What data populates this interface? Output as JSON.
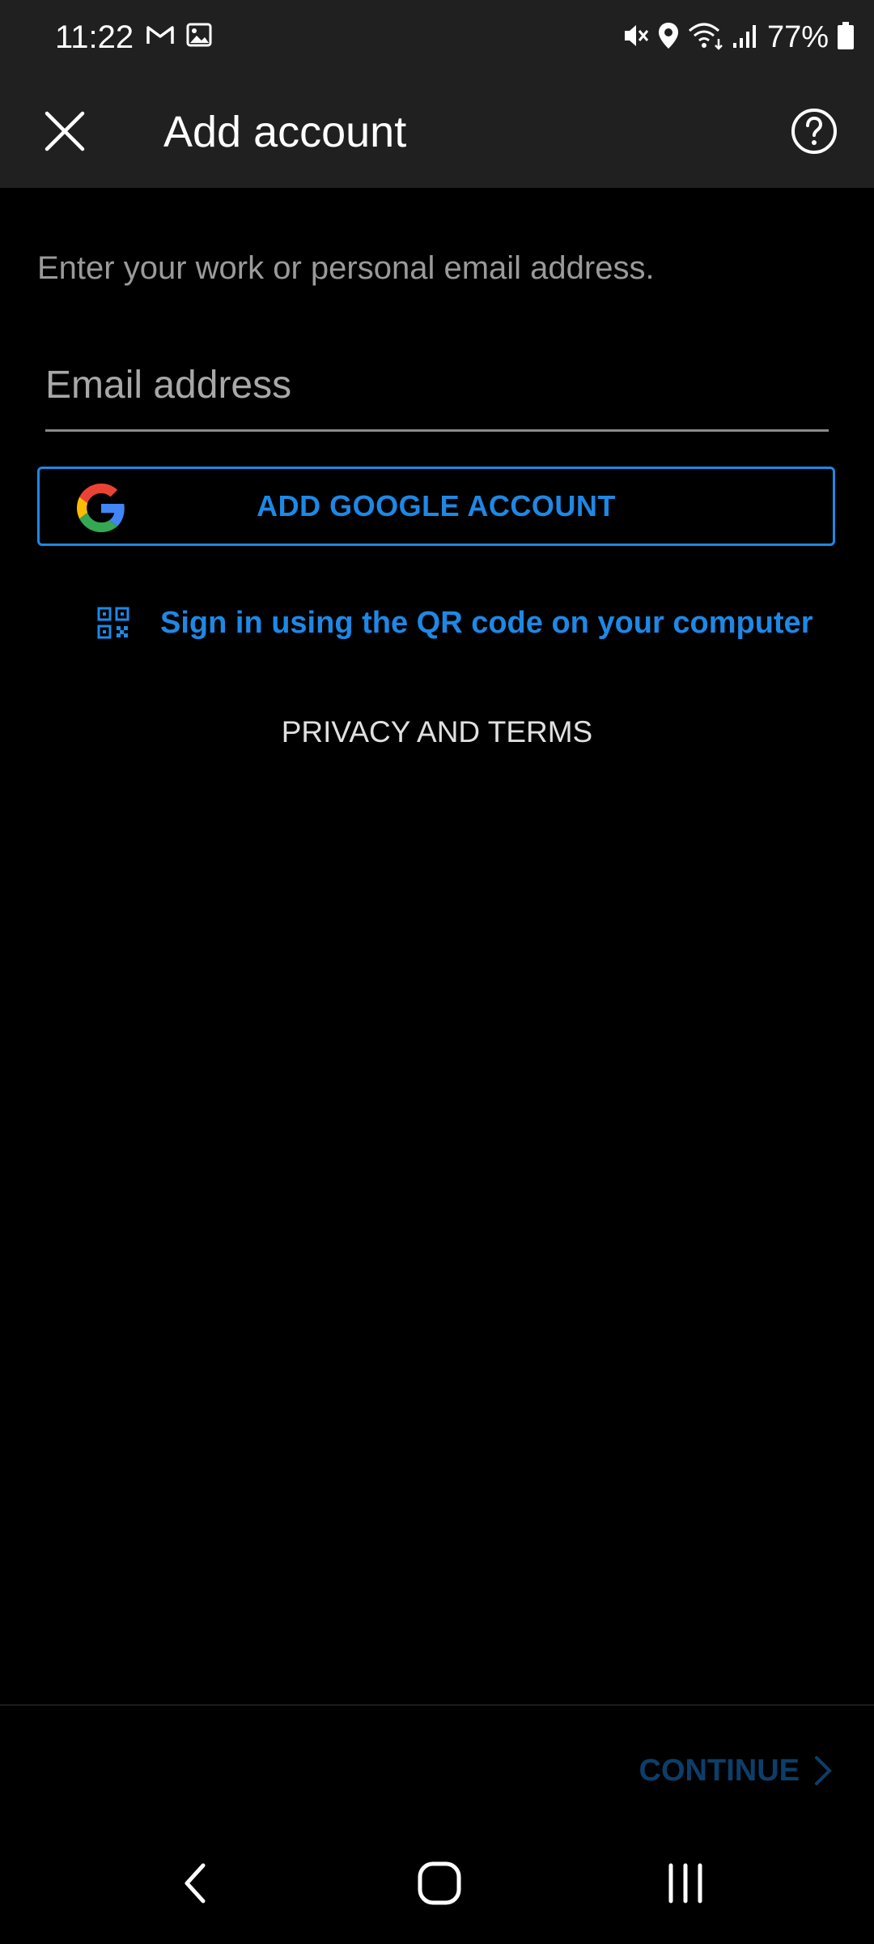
{
  "status_bar": {
    "time": "11:22",
    "battery": "77%",
    "icons": [
      "gmail-icon",
      "gallery-icon",
      "mute-icon",
      "location-icon",
      "wifi-icon",
      "signal-icon",
      "battery-icon"
    ]
  },
  "app_bar": {
    "title": "Add account",
    "close_icon": "close-icon",
    "help_icon": "help-icon"
  },
  "form": {
    "instructions": "Enter your work or personal email address.",
    "email_placeholder": "Email address",
    "email_value": "",
    "google_button_label": "ADD GOOGLE ACCOUNT",
    "qr_link_label": "Sign in using the QR code on your computer",
    "privacy_label": "PRIVACY AND TERMS"
  },
  "footer": {
    "continue_label": "CONTINUE"
  },
  "colors": {
    "accent": "#1e88e5",
    "background": "#000000",
    "app_bar": "#202020",
    "continue_disabled": "#0c3e6a"
  }
}
